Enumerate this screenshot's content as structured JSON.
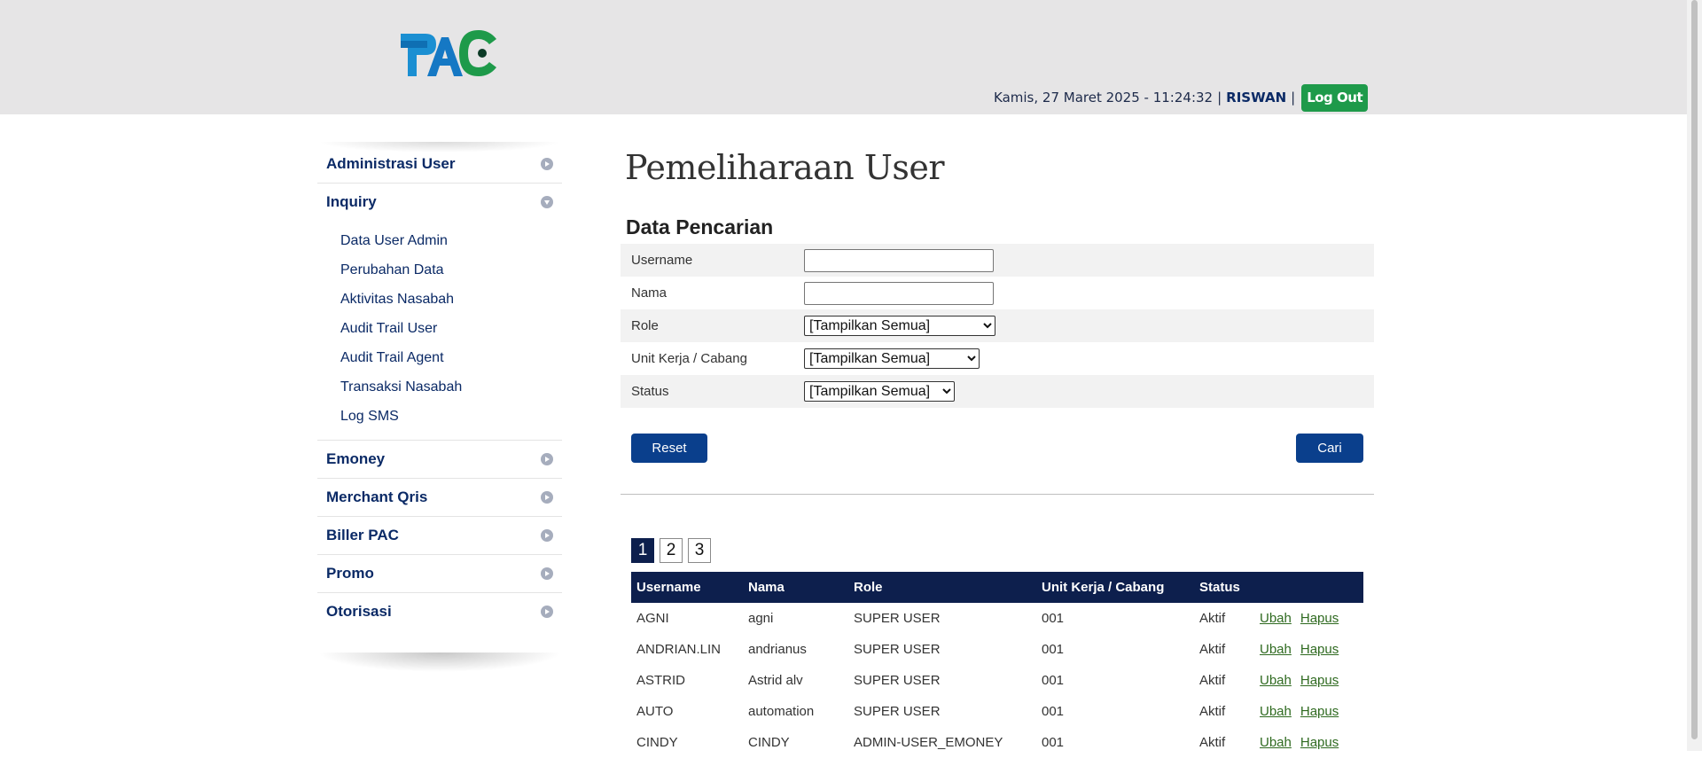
{
  "header": {
    "logo_text": "PAC",
    "datetime": "Kamis, 27 Maret 2025 - 11:24:32",
    "separator": "|",
    "username": "RISWAN",
    "logout_label": "Log Out"
  },
  "sidebar": {
    "menu_administrasi": "Administrasi User",
    "menu_inquiry": "Inquiry",
    "inquiry_items": [
      "Data User Admin",
      "Perubahan Data",
      "Aktivitas Nasabah",
      "Audit Trail User",
      "Audit Trail Agent",
      "Transaksi Nasabah",
      "Log SMS"
    ],
    "menu_emoney": "Emoney",
    "menu_merchant": "Merchant Qris",
    "menu_biller": "Biller PAC",
    "menu_promo": "Promo",
    "menu_otorisasi": "Otorisasi"
  },
  "main": {
    "page_title": "Pemeliharaan User",
    "section_title": "Data Pencarian",
    "form": {
      "username_label": "Username",
      "username_value": "",
      "nama_label": "Nama",
      "nama_value": "",
      "role_label": "Role",
      "role_selected": "[Tampilkan Semua]",
      "unit_label": "Unit Kerja / Cabang",
      "unit_selected": "[Tampilkan Semua]",
      "status_label": "Status",
      "status_selected": "[Tampilkan Semua]"
    },
    "reset_label": "Reset",
    "cari_label": "Cari",
    "pages": [
      "1",
      "2",
      "3"
    ],
    "active_page": "1",
    "table": {
      "columns": [
        "Username",
        "Nama",
        "Role",
        "Unit Kerja / Cabang",
        "Status",
        ""
      ],
      "edit_label": "Ubah",
      "delete_label": "Hapus",
      "rows": [
        [
          "AGNI",
          "agni",
          "SUPER USER",
          "001",
          "Aktif"
        ],
        [
          "ANDRIAN.LIN",
          "andrianus",
          "SUPER USER",
          "001",
          "Aktif"
        ],
        [
          "ASTRID",
          "Astrid alv",
          "SUPER USER",
          "001",
          "Aktif"
        ],
        [
          "AUTO",
          "automation",
          "SUPER USER",
          "001",
          "Aktif"
        ],
        [
          "CINDY",
          "CINDY",
          "ADMIN-USER_EMONEY",
          "001",
          "Aktif"
        ]
      ]
    }
  },
  "colors": {
    "header_bg": "#e6e5e6",
    "nav_text": "#0b2a66",
    "button_blue": "#0a3f8c",
    "table_header": "#0d1f4d",
    "logout_green": "#1e9a4a",
    "link_green": "#2f6a20"
  }
}
